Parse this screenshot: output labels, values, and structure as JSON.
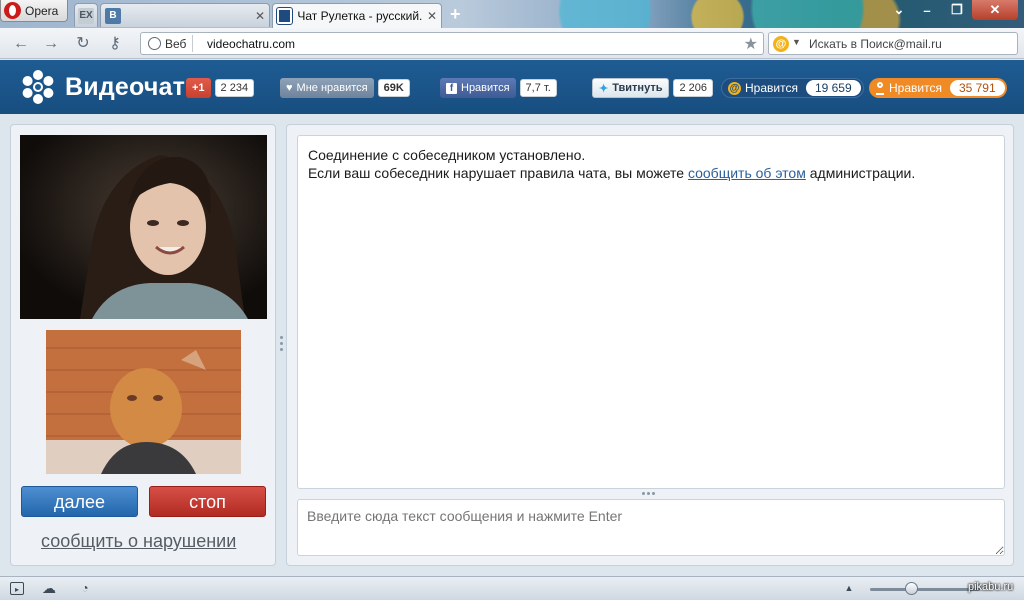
{
  "browser": {
    "menu_label": "Opera",
    "tabs": [
      {
        "label": "EX",
        "icon": "ex-favicon"
      },
      {
        "label": "В",
        "icon": "vk-favicon"
      },
      {
        "label": "Чат Рулетка - русский...",
        "icon": "videochat-favicon"
      }
    ],
    "address": {
      "chip_label": "Веб",
      "url": "videochatru.com"
    },
    "search": {
      "placeholder": "Искать в Поиск@mail.ru"
    }
  },
  "site": {
    "logo_text": "Видеочат",
    "social": {
      "gplus": {
        "label": "+1",
        "count": "2 234"
      },
      "like": {
        "label": "Мне нравится",
        "count": "69K"
      },
      "facebook": {
        "label": "Нравится",
        "count": "7,7 т."
      },
      "twitter": {
        "label": "Твитнуть",
        "count": "2 206"
      },
      "mailru": {
        "label": "Нравится",
        "count": "19 659"
      },
      "odnoklassniki": {
        "label": "Нравится",
        "count": "35 791"
      }
    },
    "colors": {
      "header": "#1e5c93",
      "next_button": "#2f78c0",
      "stop_button": "#c43a31",
      "ok_orange": "#f08a24"
    }
  },
  "controls": {
    "next_label": "далее",
    "stop_label": "стоп",
    "report_label": "сообщить о нарушении"
  },
  "chat": {
    "line1": "Соединение с собеседником установлено.",
    "line2_before": "Если ваш собеседник нарушает правила чата, вы можете ",
    "line2_link": "сообщить об этом",
    "line2_after": " администрации.",
    "input_placeholder": "Введите сюда текст сообщения и нажмите Enter"
  },
  "statusbar": {
    "watermark": "pikabu.ru"
  }
}
